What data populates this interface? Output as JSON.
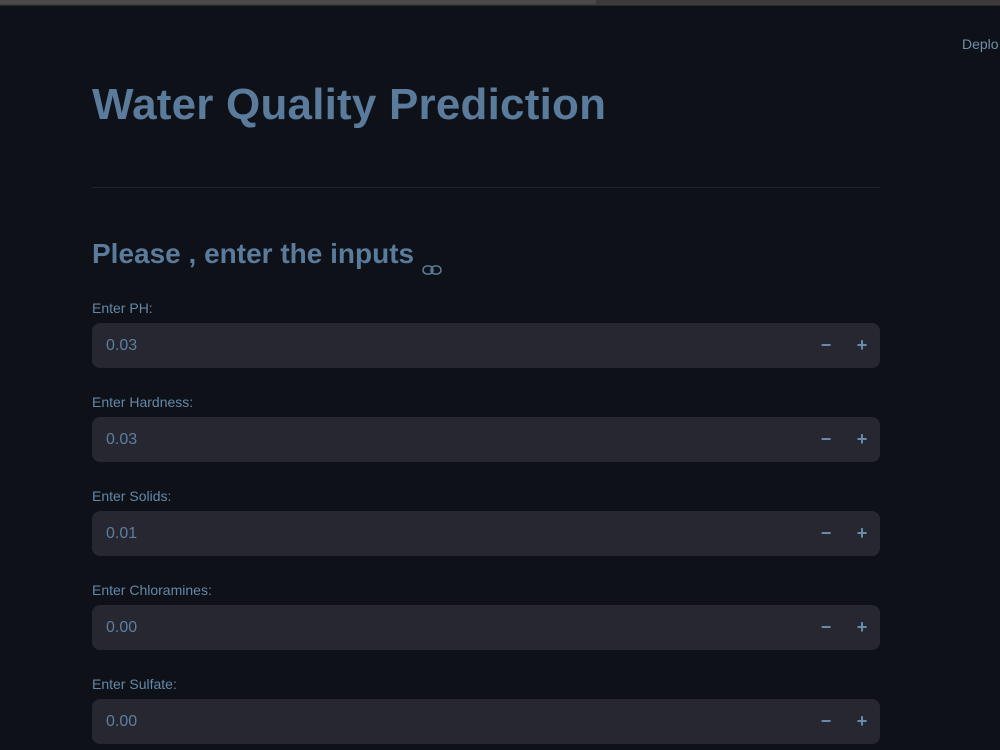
{
  "header": {
    "deploy_label": "Deplo"
  },
  "page": {
    "title": "Water Quality Prediction",
    "subtitle": "Please , enter the inputs"
  },
  "fields": [
    {
      "label": "Enter PH:",
      "value": "0.03"
    },
    {
      "label": "Enter Hardness:",
      "value": "0.03"
    },
    {
      "label": "Enter Solids:",
      "value": "0.01"
    },
    {
      "label": "Enter Chloramines:",
      "value": "0.00"
    },
    {
      "label": "Enter Sulfate:",
      "value": "0.00"
    }
  ],
  "stepper": {
    "minus": "−",
    "plus": "+"
  },
  "colors": {
    "background": "#0e1117",
    "input_background": "#262730",
    "text_accent": "#5a7b9b"
  },
  "icons": {
    "heading_anchor": "link-icon"
  }
}
